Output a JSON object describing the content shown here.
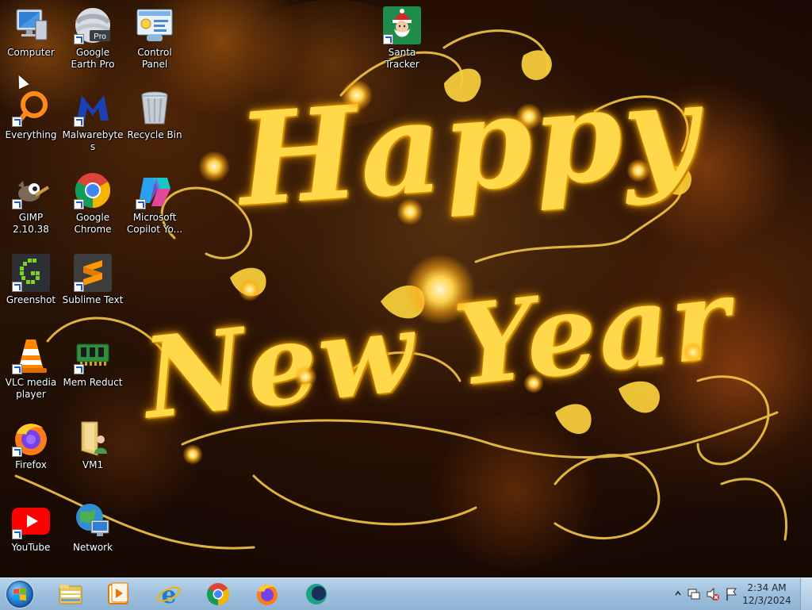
{
  "wallpaper": {
    "line1": "Happy",
    "line2": "New Year"
  },
  "desktop": {
    "icons": [
      {
        "label": "Computer"
      },
      {
        "label": "Google Earth Pro"
      },
      {
        "label": "Control Panel"
      },
      {
        "label": "Santa Tracker"
      },
      {
        "label": "Everything"
      },
      {
        "label": "Malwarebytes"
      },
      {
        "label": "Recycle Bin"
      },
      {
        "label": "GIMP 2.10.38"
      },
      {
        "label": "Google Chrome"
      },
      {
        "label": "Microsoft Copilot  Yo..."
      },
      {
        "label": "Greenshot"
      },
      {
        "label": "Sublime Text"
      },
      {
        "label": "VLC media player"
      },
      {
        "label": "Mem Reduct"
      },
      {
        "label": "Firefox"
      },
      {
        "label": "VM1"
      },
      {
        "label": "YouTube"
      },
      {
        "label": "Network"
      }
    ],
    "google_earth_badge": "Pro"
  },
  "taskbar": {
    "pinned": [
      "start-orb",
      "file-explorer",
      "media-player",
      "internet-explorer",
      "google-chrome",
      "firefox",
      "pinned-app"
    ],
    "clock": {
      "time": "2:34 AM",
      "date": "12/3/2024"
    }
  },
  "colors": {
    "taskbar": "#9dbfdc",
    "label_text": "#ffffff",
    "wallpaper_gold": "#ffd94a"
  }
}
